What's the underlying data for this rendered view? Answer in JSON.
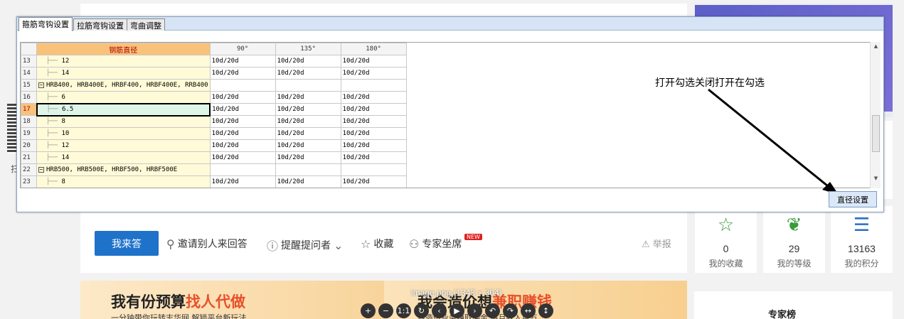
{
  "dialog": {
    "tabs": [
      {
        "label": "箍筋弯钩设置",
        "active": true
      },
      {
        "label": "拉筋弯钩设置",
        "active": false
      },
      {
        "label": "弯曲调整",
        "active": false
      }
    ],
    "grid": {
      "columns": [
        "钢筋直径",
        "90°",
        "135°",
        "180°"
      ],
      "rows": [
        {
          "num": "13",
          "name": "12",
          "type": "child",
          "v90": "10d/20d",
          "v135": "10d/20d",
          "v180": "10d/20d"
        },
        {
          "num": "14",
          "name": "14",
          "type": "child",
          "v90": "10d/20d",
          "v135": "10d/20d",
          "v180": "10d/20d"
        },
        {
          "num": "15",
          "name": "HRB400, HRB400E, HRBF400, HRBF400E, RRB400",
          "type": "group",
          "v90": "",
          "v135": "",
          "v180": ""
        },
        {
          "num": "16",
          "name": "6",
          "type": "child",
          "v90": "10d/20d",
          "v135": "10d/20d",
          "v180": "10d/20d"
        },
        {
          "num": "17",
          "name": "6.5",
          "type": "child",
          "selected": true,
          "v90": "10d/20d",
          "v135": "10d/20d",
          "v180": "10d/20d"
        },
        {
          "num": "18",
          "name": "8",
          "type": "child",
          "v90": "10d/20d",
          "v135": "10d/20d",
          "v180": "10d/20d"
        },
        {
          "num": "19",
          "name": "10",
          "type": "child",
          "v90": "10d/20d",
          "v135": "10d/20d",
          "v180": "10d/20d"
        },
        {
          "num": "20",
          "name": "12",
          "type": "child",
          "v90": "10d/20d",
          "v135": "10d/20d",
          "v180": "10d/20d"
        },
        {
          "num": "21",
          "name": "14",
          "type": "child",
          "v90": "10d/20d",
          "v135": "10d/20d",
          "v180": "10d/20d"
        },
        {
          "num": "22",
          "name": "HRB500, HRB500E, HRBF500, HRBF500E",
          "type": "group",
          "v90": "",
          "v135": "",
          "v180": ""
        },
        {
          "num": "23",
          "name": "8",
          "type": "child",
          "v90": "10d/20d",
          "v135": "10d/20d",
          "v180": "10d/20d"
        }
      ]
    },
    "annotation": "打开勾选关闭打开在勾选",
    "diameter_button": "直径设置",
    "accent_color": "#f9c27a"
  },
  "page": {
    "qr_label": "扫",
    "answer_button": "我来答",
    "invite": "邀请别人来回答",
    "remind": "提醒提问者",
    "collect": "收藏",
    "expert": "专家坐席",
    "new_badge": "NEW",
    "report": "举报",
    "stats": [
      {
        "num": "0",
        "label": "我的收藏",
        "icon": "star-icon"
      },
      {
        "num": "29",
        "label": "我的等级",
        "icon": "leaf-icon"
      },
      {
        "num": "13163",
        "label": "我的积分",
        "icon": "coins-icon"
      }
    ],
    "banner_left": {
      "title_a": "我有份预算",
      "title_b": "找人代做",
      "sub": "一分钟带你玩转志华网 解锁平台新玩法"
    },
    "banner_right": {
      "title_a": "我会造价想",
      "title_b": "兼职赚钱",
      "sub": "做造价业务赚取佣金 每月收入百万"
    },
    "expert_board": "专家榜",
    "brand_color": "#1f72c9"
  },
  "viewer": {
    "caption": "image.png (1343 × 304)",
    "tools": [
      "+",
      "−",
      "1:1",
      "↻",
      "‹",
      "▶",
      "›",
      "↶",
      "↷",
      "↔",
      "↕"
    ]
  }
}
